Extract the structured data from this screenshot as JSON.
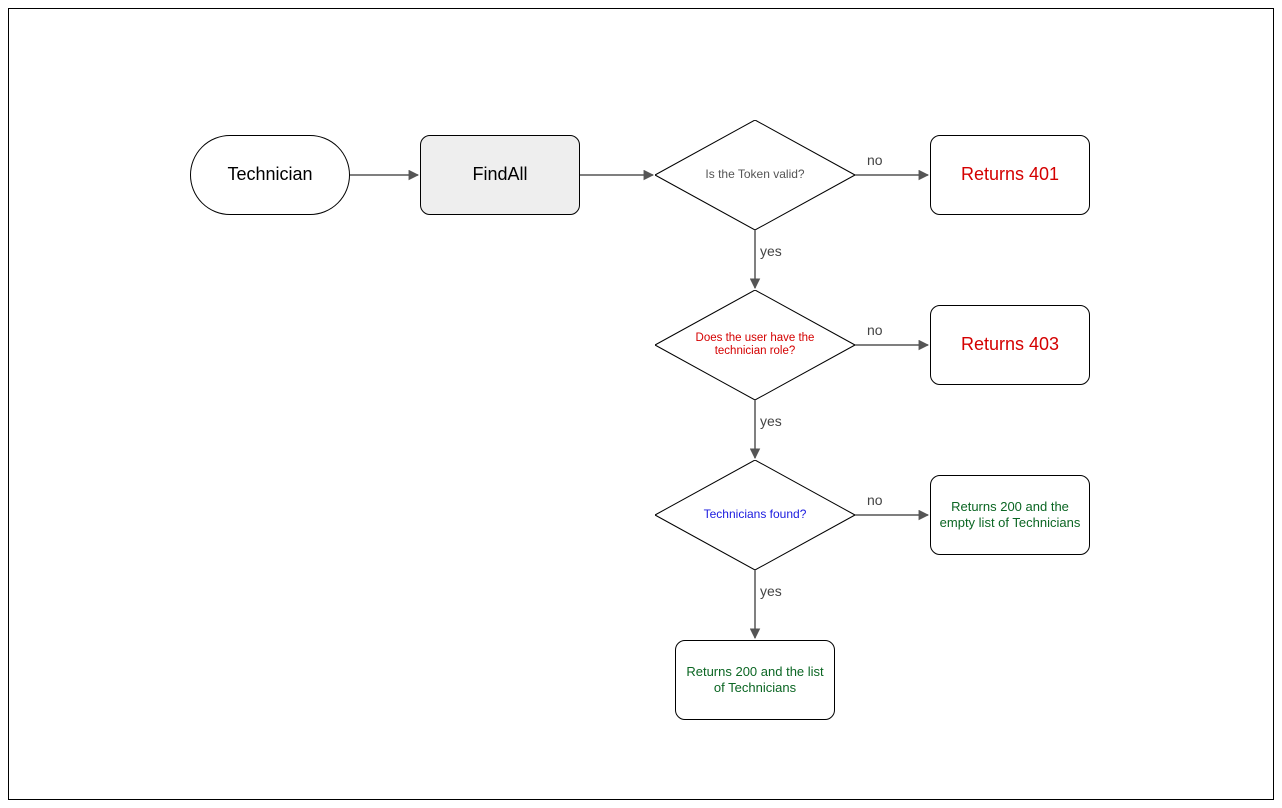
{
  "nodes": {
    "start": "Technician",
    "process": "FindAll",
    "decision1": "Is the Token valid?",
    "decision2": "Does the user have the technician role?",
    "decision3": "Technicians found?",
    "result401": "Returns 401",
    "result403": "Returns 403",
    "result200empty": "Returns 200 and the empty list of Technicians",
    "result200list": "Returns 200 and the list of Technicians"
  },
  "labels": {
    "no": "no",
    "yes": "yes"
  },
  "chart_data": {
    "type": "flowchart",
    "nodes": [
      {
        "id": "start",
        "shape": "terminator",
        "label": "Technician"
      },
      {
        "id": "process",
        "shape": "process",
        "label": "FindAll"
      },
      {
        "id": "d1",
        "shape": "decision",
        "label": "Is the Token valid?"
      },
      {
        "id": "r401",
        "shape": "result",
        "label": "Returns 401",
        "color": "red"
      },
      {
        "id": "d2",
        "shape": "decision",
        "label": "Does the user have the technician role?"
      },
      {
        "id": "r403",
        "shape": "result",
        "label": "Returns 403",
        "color": "red"
      },
      {
        "id": "d3",
        "shape": "decision",
        "label": "Technicians found?"
      },
      {
        "id": "r200e",
        "shape": "result",
        "label": "Returns 200 and the empty list of Technicians",
        "color": "green"
      },
      {
        "id": "r200l",
        "shape": "result",
        "label": "Returns 200 and the list of Technicians",
        "color": "green"
      }
    ],
    "edges": [
      {
        "from": "start",
        "to": "process"
      },
      {
        "from": "process",
        "to": "d1"
      },
      {
        "from": "d1",
        "to": "r401",
        "label": "no"
      },
      {
        "from": "d1",
        "to": "d2",
        "label": "yes"
      },
      {
        "from": "d2",
        "to": "r403",
        "label": "no"
      },
      {
        "from": "d2",
        "to": "d3",
        "label": "yes"
      },
      {
        "from": "d3",
        "to": "r200e",
        "label": "no"
      },
      {
        "from": "d3",
        "to": "r200l",
        "label": "yes"
      }
    ]
  }
}
